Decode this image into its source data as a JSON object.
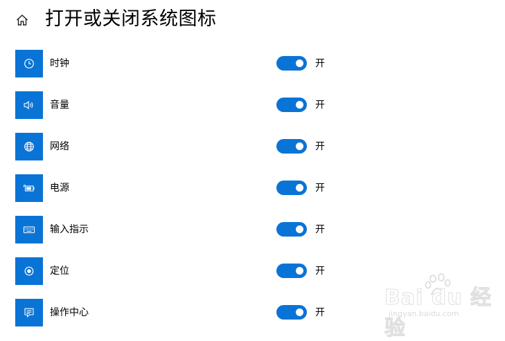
{
  "header": {
    "title": "打开或关闭系统图标",
    "home_icon": "home-icon"
  },
  "accent_color": "#0a74d6",
  "items": [
    {
      "label": "时钟",
      "icon": "clock-icon",
      "state": "开",
      "on": true
    },
    {
      "label": "音量",
      "icon": "volume-icon",
      "state": "开",
      "on": true
    },
    {
      "label": "网络",
      "icon": "network-globe-icon",
      "state": "开",
      "on": true
    },
    {
      "label": "电源",
      "icon": "power-battery-icon",
      "state": "开",
      "on": true
    },
    {
      "label": "输入指示",
      "icon": "keyboard-icon",
      "state": "开",
      "on": true
    },
    {
      "label": "定位",
      "icon": "location-icon",
      "state": "开",
      "on": true
    },
    {
      "label": "操作中心",
      "icon": "action-center-icon",
      "state": "开",
      "on": true
    }
  ],
  "watermark": {
    "brand": "Bai du 经验",
    "url": "jingyan.baidu.com"
  }
}
